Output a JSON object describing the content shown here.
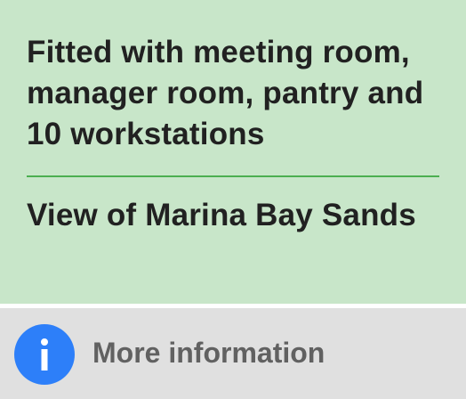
{
  "features": {
    "description": "Fitted with meeting room, manager room, pantry and 10 workstations",
    "view": "View of Marina Bay Sands"
  },
  "info_bar": {
    "label": "More information",
    "icon": "info-icon",
    "icon_color": "#2d7ff9"
  },
  "colors": {
    "card_background": "#c8e6c9",
    "divider": "#4caf50",
    "info_bar_background": "#e0e0e0"
  }
}
